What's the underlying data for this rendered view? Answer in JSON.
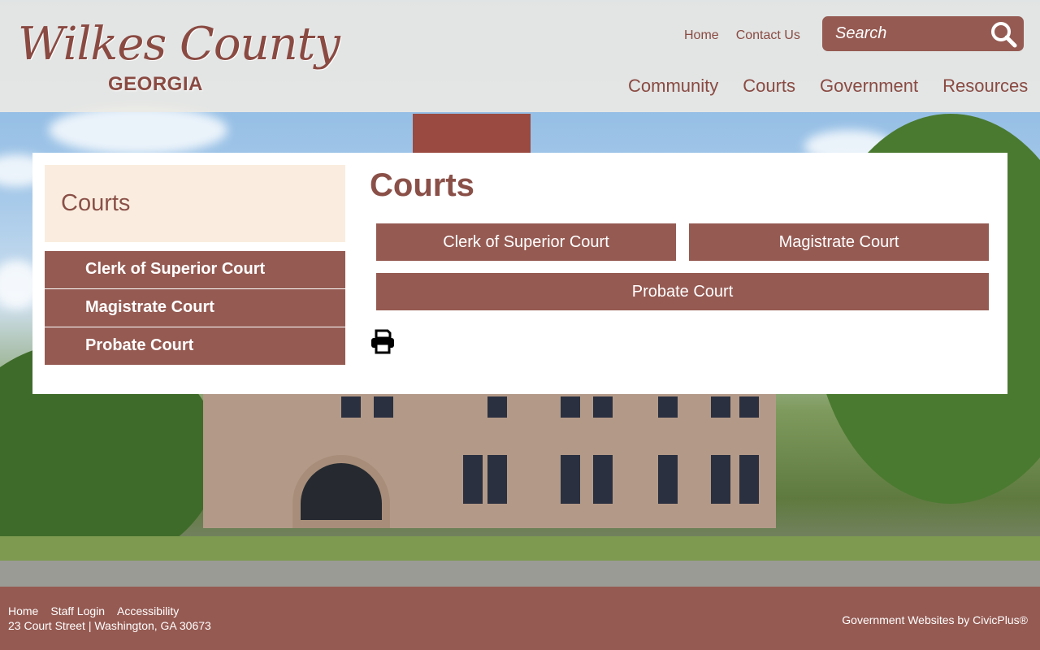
{
  "logo": {
    "main": "Wilkes County",
    "sub": "GEORGIA"
  },
  "utility_nav": [
    {
      "label": "Home"
    },
    {
      "label": "Contact Us"
    }
  ],
  "search": {
    "placeholder": "Search"
  },
  "main_nav": [
    {
      "label": "Community"
    },
    {
      "label": "Courts"
    },
    {
      "label": "Government"
    },
    {
      "label": "Resources"
    }
  ],
  "sidebar": {
    "title": "Courts",
    "items": [
      {
        "label": "Clerk of Superior Court"
      },
      {
        "label": "Magistrate Court"
      },
      {
        "label": "Probate Court"
      }
    ]
  },
  "main": {
    "title": "Courts",
    "buttons": [
      {
        "label": "Clerk of Superior Court"
      },
      {
        "label": "Magistrate Court"
      },
      {
        "label": "Probate Court"
      }
    ]
  },
  "footer": {
    "links": [
      {
        "label": "Home"
      },
      {
        "label": "Staff Login"
      },
      {
        "label": "Accessibility"
      }
    ],
    "address": "23 Court Street | Washington, GA 30673",
    "credit": "Government Websites by CivicPlus®"
  },
  "colors": {
    "brand": "#955a52",
    "brand_text": "#8a4a42",
    "sidebar_title_bg": "#faeddf",
    "header_bg": "#eceae4"
  },
  "icons": {
    "search": "search-icon",
    "print": "printer-icon"
  }
}
